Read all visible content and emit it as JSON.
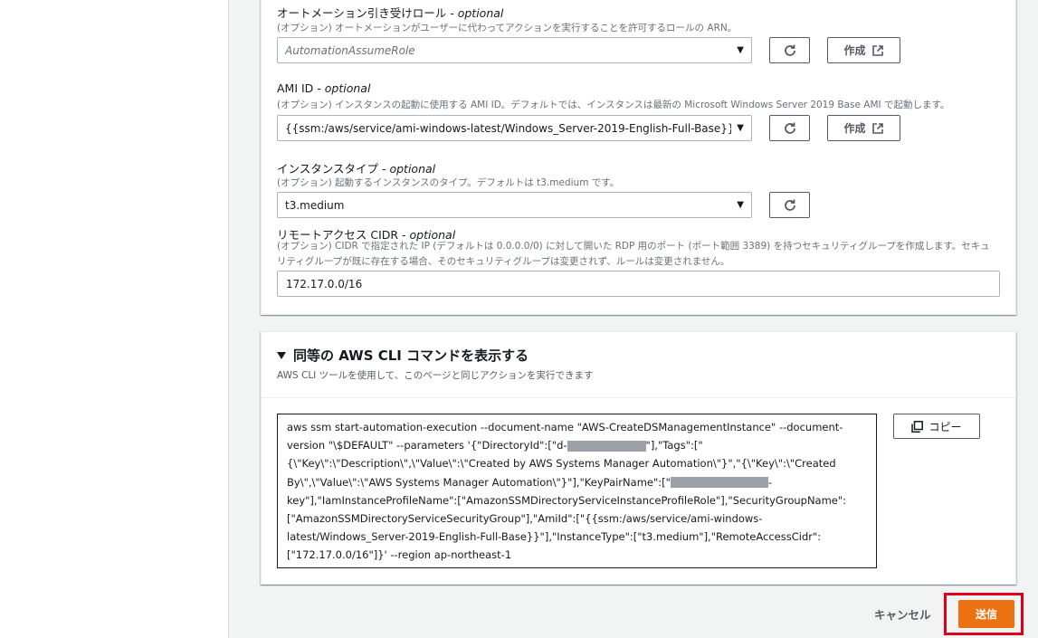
{
  "params": {
    "automation_role": {
      "label": "オートメーション引き受けロール",
      "optional": " - optional",
      "description": "(オプション) オートメーションがユーザーに代わってアクションを実行することを許可するロールの ARN。",
      "placeholder": "AutomationAssumeRole"
    },
    "ami_id": {
      "label": "AMI ID",
      "optional": " - optional",
      "description": "(オプション) インスタンスの起動に使用する AMI ID。デフォルトでは、インスタンスは最新の Microsoft Windows Server 2019 Base AMI で起動します。",
      "value": "{{ssm:/aws/service/ami-windows-latest/Windows_Server-2019-English-Full-Base}}"
    },
    "instance_type": {
      "label": "インスタンスタイプ",
      "optional": " - optional",
      "description": "(オプション) 起動するインスタンスのタイプ。デフォルトは t3.medium です。",
      "value": "t3.medium"
    },
    "remote_access_cidr": {
      "label": "リモートアクセス CIDR",
      "optional": " - optional",
      "description": "(オプション) CIDR で指定された IP (デフォルトは 0.0.0.0/0) に対して開いた RDP 用のポート (ポート範囲 3389) を持つセキュリティグループを作成します。セキュリティグループが既に存在する場合、そのセキュリティグループは変更されず、ルールは変更されません。",
      "value": "172.17.0.0/16"
    },
    "create_label": "作成"
  },
  "cli": {
    "title": "同等の AWS CLI コマンドを表示する",
    "subtitle": "AWS CLI ツールを使用して、このページと同じアクションを実行できます",
    "copy_label": "コピー",
    "command_parts": [
      "aws ssm start-automation-execution --document-name \"AWS-CreateDSManagementInstance\" --document-version \"\\$DEFAULT\" --parameters '{\"DirectoryId\":[\"d-",
      "\"],\"Tags\":[\"{\\\"Key\\\":\\\"Description\\\",\\\"Value\\\":\\\"Created by AWS Systems Manager Automation\\\"}\",\"{\\\"Key\\\":\\\"Created By\\\",\\\"Value\\\":\\\"AWS Systems Manager Automation\\\"}\"],\"KeyPairName\":[\"",
      "-key\"],\"IamInstanceProfileName\":[\"AmazonSSMDirectoryServiceInstanceProfileRole\"],\"SecurityGroupName\":[\"AmazonSSMDirectoryServiceSecurityGroup\"],\"AmiId\":[\"{{ssm:/aws/service/ami-windows-latest/Windows_Server-2019-English-Full-Base}}\"],\"InstanceType\":[\"t3.medium\"],\"RemoteAccessCidr\":[\"172.17.0.0/16\"]}' --region ap-northeast-1"
    ]
  },
  "actions": {
    "cancel_label": "キャンセル",
    "submit_label": "送信"
  },
  "colors": {
    "primary": "#ec7211",
    "highlight": "#e0001b",
    "page_bg": "#f2f3f3"
  }
}
